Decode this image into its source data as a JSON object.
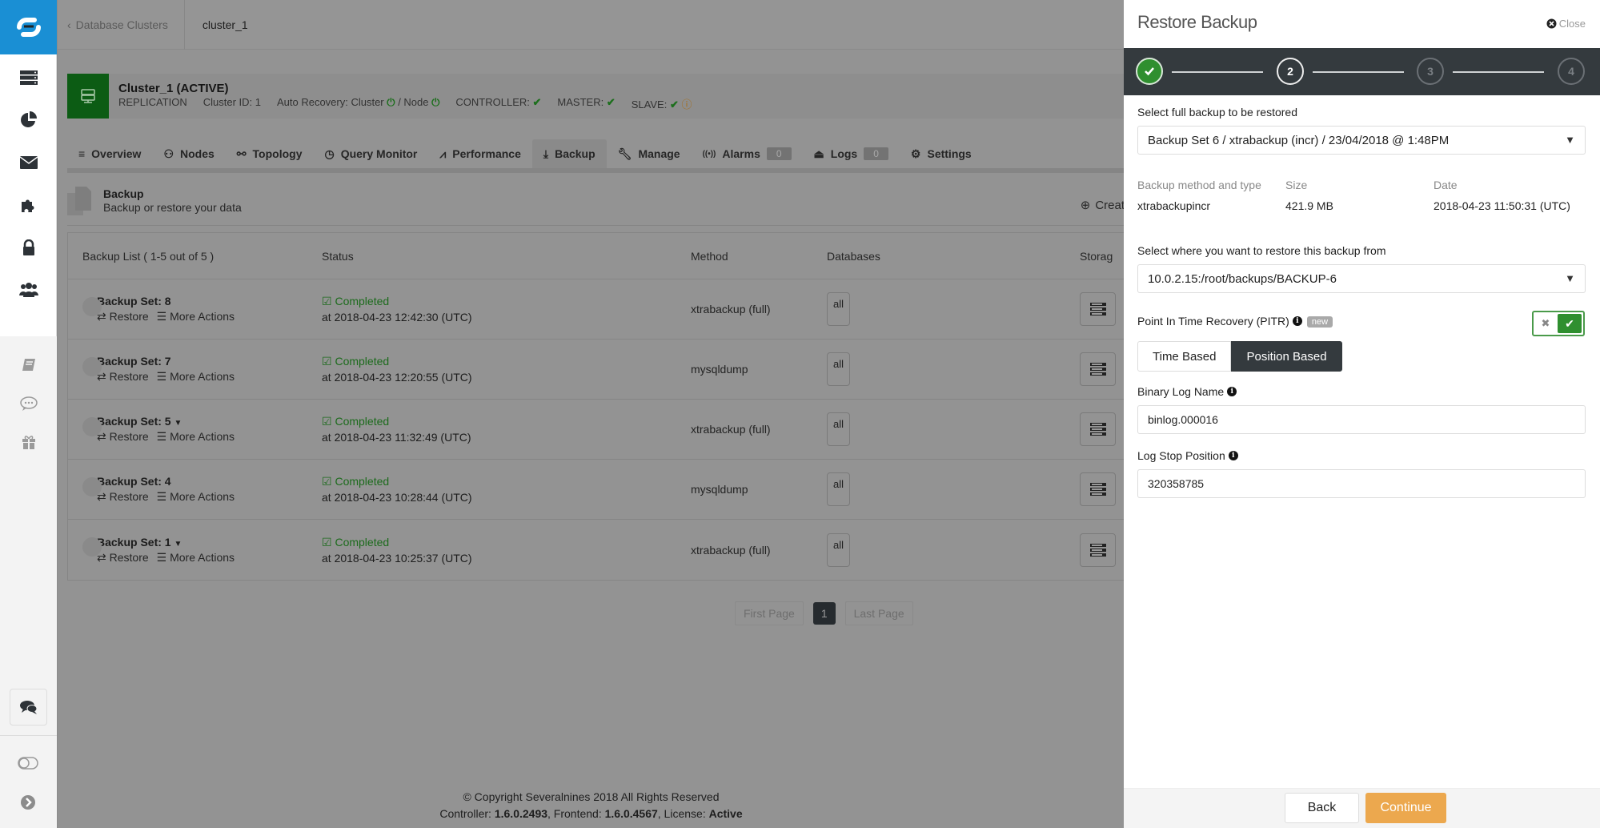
{
  "sidebar": {
    "logo": "severalnines-logo",
    "items": [
      {
        "icon": "database-clusters-icon"
      },
      {
        "icon": "ops-reports-icon"
      },
      {
        "icon": "mail-icon"
      },
      {
        "icon": "integrations-icon"
      },
      {
        "icon": "security-lock-icon"
      },
      {
        "icon": "user-management-icon"
      }
    ],
    "lower_items": [
      {
        "icon": "documentation-icon"
      },
      {
        "icon": "feedback-icon"
      },
      {
        "icon": "whats-new-gift-icon"
      }
    ]
  },
  "topbar": {
    "back_label": "Database Clusters",
    "breadcrumb": "cluster_1"
  },
  "cluster": {
    "name": "Cluster_1 (ACTIVE)",
    "type": "REPLICATION",
    "cluster_id": "Cluster ID: 1",
    "auto_recovery": "Auto Recovery: Cluster",
    "auto_recovery_node": "/ Node",
    "controller_label": "CONTROLLER:",
    "master_label": "MASTER:",
    "slave_label": "SLAVE:"
  },
  "tabs": [
    {
      "label": "Overview",
      "icon": "list-icon"
    },
    {
      "label": "Nodes",
      "icon": "nodes-icon"
    },
    {
      "label": "Topology",
      "icon": "topology-icon"
    },
    {
      "label": "Query Monitor",
      "icon": "query-monitor-icon"
    },
    {
      "label": "Performance",
      "icon": "performance-chart-icon"
    },
    {
      "label": "Backup",
      "icon": "backup-download-icon",
      "active": true
    },
    {
      "label": "Manage",
      "icon": "wrench-icon"
    },
    {
      "label": "Alarms",
      "icon": "alarm-signal-icon",
      "count": "0"
    },
    {
      "label": "Logs",
      "icon": "logs-inbox-icon",
      "count": "0"
    },
    {
      "label": "Settings",
      "icon": "gear-icon"
    }
  ],
  "section": {
    "title": "Backup",
    "subtitle": "Backup or restore your data",
    "create_label": "Creat"
  },
  "table": {
    "headers": {
      "name": "Backup List ( 1-5 out of 5 )",
      "status": "Status",
      "method": "Method",
      "databases": "Databases",
      "storage": "Storag"
    },
    "rows": [
      {
        "name": "Backup Set: 8",
        "caret": false,
        "restore": "Restore",
        "more": "More Actions",
        "status": "Completed",
        "time": "at 2018-04-23 12:42:30 (UTC)",
        "method": "xtrabackup (full)",
        "databases": "all"
      },
      {
        "name": "Backup Set: 7",
        "caret": false,
        "restore": "Restore",
        "more": "More Actions",
        "status": "Completed",
        "time": "at 2018-04-23 12:20:55 (UTC)",
        "method": "mysqldump",
        "databases": "all"
      },
      {
        "name": "Backup Set: 5",
        "caret": true,
        "restore": "Restore",
        "more": "More Actions",
        "status": "Completed",
        "time": "at 2018-04-23 11:32:49 (UTC)",
        "method": "xtrabackup (full)",
        "databases": "all"
      },
      {
        "name": "Backup Set: 4",
        "caret": false,
        "restore": "Restore",
        "more": "More Actions",
        "status": "Completed",
        "time": "at 2018-04-23 10:28:44 (UTC)",
        "method": "mysqldump",
        "databases": "all"
      },
      {
        "name": "Backup Set: 1",
        "caret": true,
        "restore": "Restore",
        "more": "More Actions",
        "status": "Completed",
        "time": "at 2018-04-23 10:25:37 (UTC)",
        "method": "xtrabackup (full)",
        "databases": "all"
      }
    ]
  },
  "pagination": {
    "first": "First Page",
    "current": "1",
    "last": "Last Page"
  },
  "footer": {
    "copyright": "© Copyright Severalnines 2018 All Rights Reserved",
    "controller_label": "Controller:",
    "controller_version": "1.6.0.2493",
    "frontend_label": ", Frontend:",
    "frontend_version": "1.6.0.4567",
    "license_label": ", License:",
    "license_status": "Active"
  },
  "panel": {
    "title": "Restore Backup",
    "close_label": "Close",
    "steps": [
      {
        "label": "1",
        "state": "done"
      },
      {
        "label": "2",
        "state": "current"
      },
      {
        "label": "3",
        "state": "todo"
      },
      {
        "label": "4",
        "state": "todo"
      }
    ],
    "select_backup_label": "Select full backup to be restored",
    "select_backup_value": "Backup Set 6 / xtrabackup (incr) / 23/04/2018 @ 1:48PM",
    "info": {
      "method_label": "Backup method and type",
      "method_value": "xtrabackupincr",
      "size_label": "Size",
      "size_value": "421.9 MB",
      "date_label": "Date",
      "date_value": "2018-04-23 11:50:31 (UTC)"
    },
    "restore_from_label": "Select where you want to restore this backup from",
    "restore_from_value": "10.0.2.15:/root/backups/BACKUP-6",
    "pitr_label": "Point In Time Recovery (PITR)",
    "pitr_badge": "new",
    "pitr_enabled": true,
    "mode_options": [
      "Time Based",
      "Position Based"
    ],
    "mode_selected": "Position Based",
    "binlog_label": "Binary Log Name",
    "binlog_value": "binlog.000016",
    "stop_pos_label": "Log Stop Position",
    "stop_pos_value": "320358785",
    "back_label": "Back",
    "continue_label": "Continue"
  },
  "colors": {
    "brand_blue": "#1a8fd4",
    "cluster_green": "#0c5c14",
    "success_green": "#2f8f2f",
    "continue_orange": "#eca84e",
    "stepper_dark": "#343a3e"
  }
}
